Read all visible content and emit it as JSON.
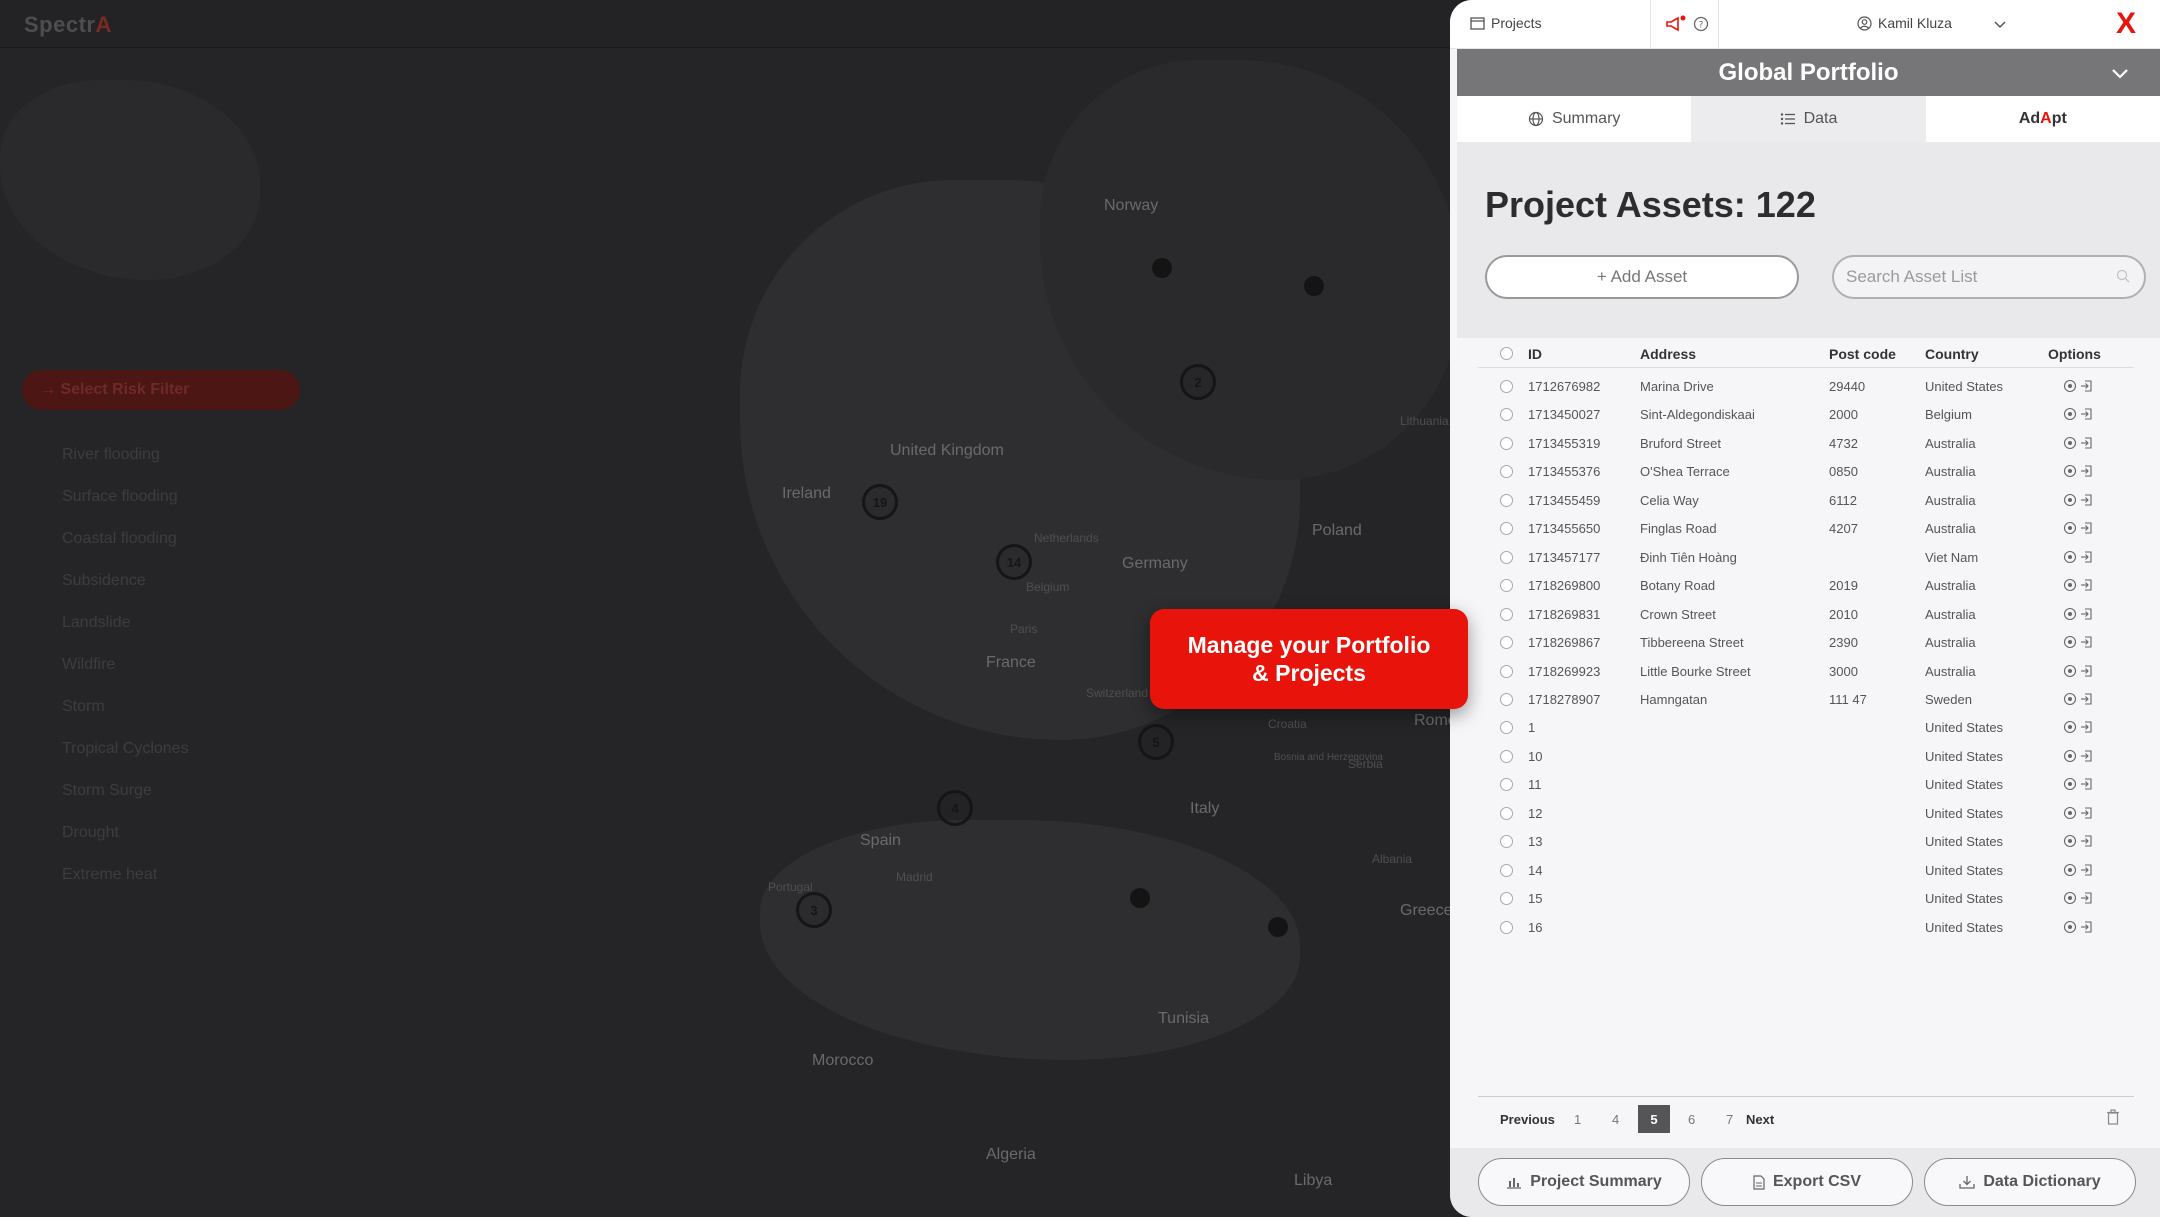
{
  "app": {
    "logo_main": "Spectr",
    "logo_accent": "A"
  },
  "risk_filter": {
    "button_label": "→ Select Risk Filter",
    "items": [
      "River flooding",
      "Surface flooding",
      "Coastal flooding",
      "Subsidence",
      "Landslide",
      "Wildfire",
      "Storm",
      "Tropical Cyclones",
      "Storm Surge",
      "Drought",
      "Extreme heat"
    ]
  },
  "map": {
    "labels": [
      "Norway",
      "United Kingdom",
      "Ireland",
      "Poland",
      "Germany",
      "Netherlands",
      "Belgium",
      "France",
      "Italy",
      "Spain",
      "Portugal",
      "Tunisia",
      "Morocco",
      "Algeria",
      "Libya",
      "Croatia",
      "Serbia",
      "Bosnia and Herzegovina",
      "Greece",
      "Albania",
      "Switzerland",
      "Paris",
      "Madrid",
      "Rome",
      "Lithuania"
    ],
    "clusters": [
      "2",
      "19",
      "14",
      "5",
      "4",
      "3"
    ]
  },
  "callout": {
    "line1": "Manage your Portfolio",
    "line2": "& Projects"
  },
  "panel": {
    "projects_label": "Projects",
    "user_name": "Kamil Kluza",
    "close_label": "X",
    "portfolio_title": "Global Portfolio",
    "tabs": {
      "summary": "Summary",
      "data": "Data",
      "adapt_pre": "Ad",
      "adapt_a": "A",
      "adapt_post": "pt"
    },
    "assets_title": "Project Assets: 122",
    "add_asset_label": "+ Add Asset",
    "search_placeholder": "Search Asset List",
    "columns": {
      "id": "ID",
      "address": "Address",
      "post_code": "Post code",
      "country": "Country",
      "options": "Options"
    },
    "rows": [
      {
        "id": "1712676982",
        "address": "Marina Drive",
        "post": "29440",
        "country": "United States"
      },
      {
        "id": "1713450027",
        "address": "Sint-Aldegondiskaai",
        "post": "2000",
        "country": "Belgium"
      },
      {
        "id": "1713455319",
        "address": "Bruford Street",
        "post": "4732",
        "country": "Australia"
      },
      {
        "id": "1713455376",
        "address": "O'Shea Terrace",
        "post": "0850",
        "country": "Australia"
      },
      {
        "id": "1713455459",
        "address": "Celia Way",
        "post": "6112",
        "country": "Australia"
      },
      {
        "id": "1713455650",
        "address": "Finglas Road",
        "post": "4207",
        "country": "Australia"
      },
      {
        "id": "1713457177",
        "address": "Đinh Tiên Hoàng",
        "post": "",
        "country": "Viet Nam"
      },
      {
        "id": "1718269800",
        "address": "Botany Road",
        "post": "2019",
        "country": "Australia"
      },
      {
        "id": "1718269831",
        "address": "Crown Street",
        "post": "2010",
        "country": "Australia"
      },
      {
        "id": "1718269867",
        "address": "Tibbereena Street",
        "post": "2390",
        "country": "Australia"
      },
      {
        "id": "1718269923",
        "address": "Little Bourke Street",
        "post": "3000",
        "country": "Australia"
      },
      {
        "id": "1718278907",
        "address": "Hamngatan",
        "post": "111 47",
        "country": "Sweden"
      },
      {
        "id": "1",
        "address": "",
        "post": "",
        "country": "United States"
      },
      {
        "id": "10",
        "address": "",
        "post": "",
        "country": "United States"
      },
      {
        "id": "11",
        "address": "",
        "post": "",
        "country": "United States"
      },
      {
        "id": "12",
        "address": "",
        "post": "",
        "country": "United States"
      },
      {
        "id": "13",
        "address": "",
        "post": "",
        "country": "United States"
      },
      {
        "id": "14",
        "address": "",
        "post": "",
        "country": "United States"
      },
      {
        "id": "15",
        "address": "",
        "post": "",
        "country": "United States"
      },
      {
        "id": "16",
        "address": "",
        "post": "",
        "country": "United States"
      }
    ],
    "pagination": {
      "previous": "Previous",
      "pages": [
        "1",
        "4",
        "5",
        "6",
        "7"
      ],
      "current": "5",
      "next": "Next"
    },
    "footer": {
      "project_summary": "Project Summary",
      "export_csv": "Export CSV",
      "data_dictionary": "Data Dictionary"
    }
  },
  "colors": {
    "accent": "#e8130a",
    "portfolio_bar": "#767678",
    "map_bg": "#252527"
  }
}
